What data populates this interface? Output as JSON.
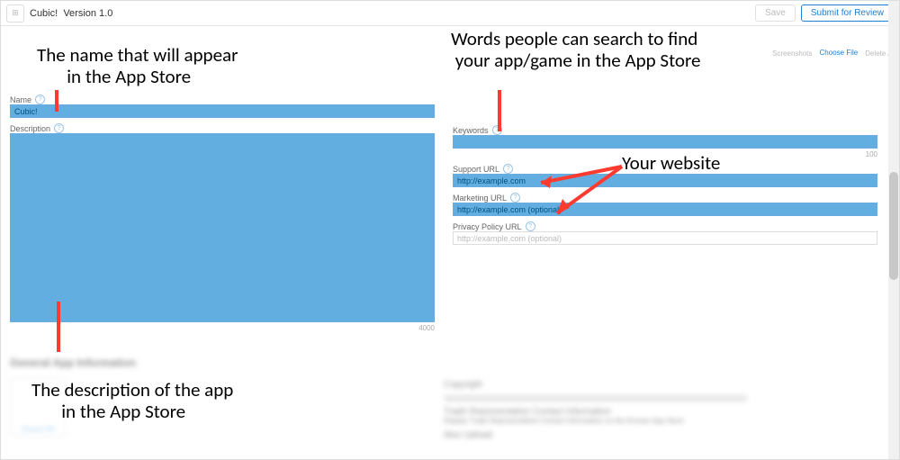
{
  "header": {
    "app_name": "Cubic!",
    "version_label": "Version 1.0",
    "save_label": "Save",
    "submit_label": "Submit for Review"
  },
  "left": {
    "name_label": "Name",
    "name_value": "Cubic!",
    "description_label": "Description",
    "description_value": "",
    "description_max": "4000"
  },
  "right": {
    "screenshots_label": "Screenshots",
    "choose_file_label": "Choose File",
    "delete_all_label": "Delete All",
    "keywords_label": "Keywords",
    "keywords_value": "",
    "keywords_max": "100",
    "support_url_label": "Support URL",
    "support_url_placeholder": "http://example.com",
    "marketing_url_label": "Marketing URL",
    "marketing_url_placeholder": "http://example.com (optional)",
    "privacy_url_label": "Privacy Policy URL",
    "privacy_url_placeholder": "http://example.com (optional)"
  },
  "lower": {
    "section_title": "General App Information",
    "choose_file": "Choose File",
    "copyright_label": "Copyright",
    "trade_rep_label": "Trade Representative Contact Information",
    "trade_rep_checkbox": "Display Trade Representative Contact Information on the Korean App Store",
    "also_label": "Also Upload"
  },
  "annotations": {
    "name_note_l1": "The name that will appear",
    "name_note_l2": "in the App Store",
    "desc_note_l1": "The description of the app",
    "desc_note_l2": "in the App Store",
    "keywords_note_l1": "Words people can search to find",
    "keywords_note_l2": "your app/game in the App Store",
    "url_note": "Your website"
  }
}
